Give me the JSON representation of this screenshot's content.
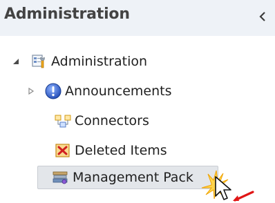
{
  "pane": {
    "title": "Administration"
  },
  "tree": {
    "root_label": "Administration",
    "children": [
      {
        "label": "Announcements"
      },
      {
        "label": "Connectors"
      },
      {
        "label": "Deleted Items"
      },
      {
        "label": "Management Pack"
      }
    ]
  }
}
